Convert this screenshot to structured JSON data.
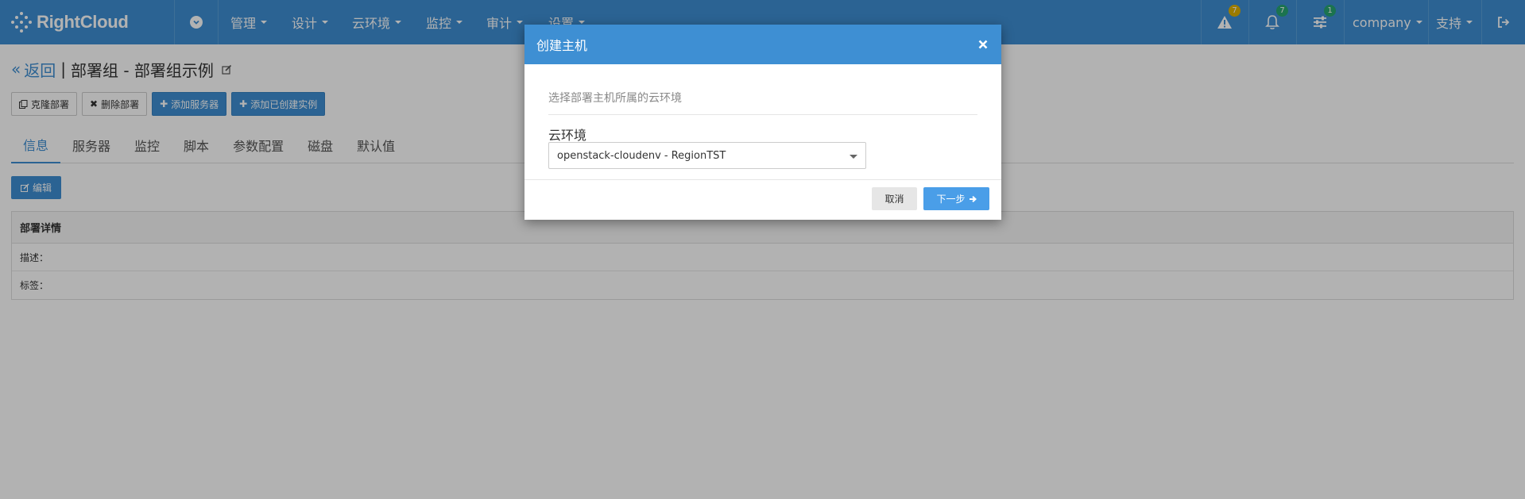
{
  "app": {
    "brand": "RightCloud"
  },
  "navbar": {
    "items": [
      {
        "label": "管理"
      },
      {
        "label": "设计"
      },
      {
        "label": "云环境"
      },
      {
        "label": "监控"
      },
      {
        "label": "审计"
      },
      {
        "label": "设置"
      }
    ],
    "alerts_badge": "7",
    "notifications_badge": "7",
    "tasks_badge": "1",
    "company_label": "company",
    "support_label": "支持"
  },
  "page": {
    "back_label": "返回",
    "title": "部署组 - 部署组示例",
    "buttons": {
      "clone": "克隆部署",
      "delete": "删除部署",
      "add_server": "添加服务器",
      "add_instance": "添加已创建实例"
    },
    "tabs": [
      "信息",
      "服务器",
      "监控",
      "脚本",
      "参数配置",
      "磁盘",
      "默认值"
    ],
    "edit_label": "编辑",
    "detail": {
      "heading": "部署详情",
      "description_label": "描述：",
      "tags_label": "标签："
    }
  },
  "modal": {
    "title": "创建主机",
    "description": "选择部署主机所属的云环境",
    "field_label": "云环境",
    "selected_value": "openstack-cloudenv - RegionTST",
    "cancel_label": "取消",
    "next_label": "下一步"
  },
  "colors": {
    "brand_blue": "#3e8fd3",
    "badge_yellow": "#e0b000",
    "badge_green": "#27a571"
  }
}
